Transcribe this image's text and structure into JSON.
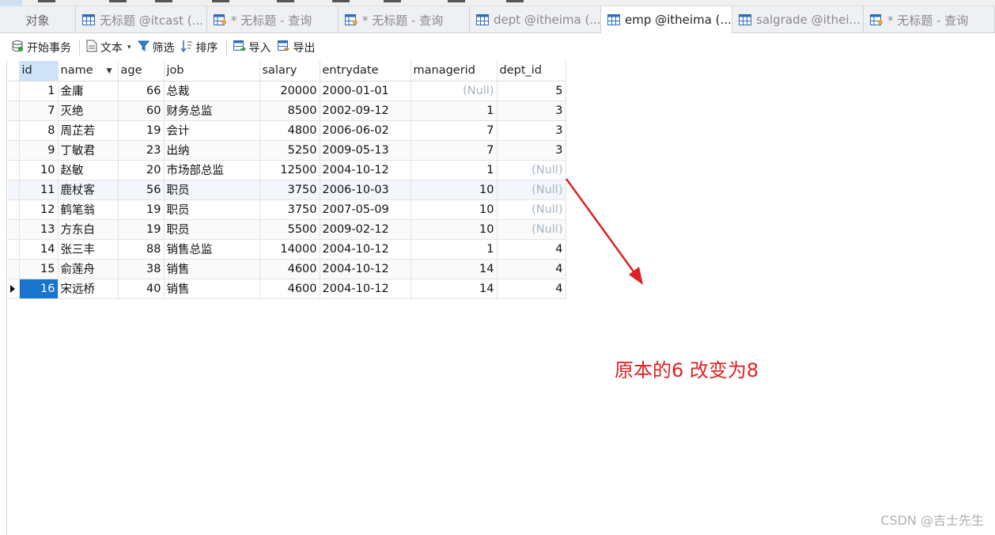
{
  "tabs": [
    {
      "label": "对象",
      "icon": "none",
      "active": false
    },
    {
      "label": "无标题 @itcast (...",
      "icon": "table-icon",
      "active": false
    },
    {
      "label": "* 无标题 - 查询",
      "icon": "query-icon",
      "active": false
    },
    {
      "label": "* 无标题 - 查询",
      "icon": "query-icon",
      "active": false
    },
    {
      "label": "dept @itheima (...",
      "icon": "table-icon",
      "active": false
    },
    {
      "label": "emp @itheima (...",
      "icon": "table-icon",
      "active": true
    },
    {
      "label": "salgrade @ithei...",
      "icon": "table-icon",
      "active": false
    },
    {
      "label": "* 无标题 - 查询",
      "icon": "query-icon",
      "active": false
    }
  ],
  "toolbar": {
    "begin_transaction": "开始事务",
    "text": "文本",
    "filter": "筛选",
    "sort": "排序",
    "import": "导入",
    "export": "导出"
  },
  "grid": {
    "columns": [
      "id",
      "name",
      "age",
      "job",
      "salary",
      "entrydate",
      "managerid",
      "dept_id"
    ],
    "null_text": "(Null)",
    "rows": [
      {
        "id": "1",
        "name": "金庸",
        "age": "66",
        "job": "总裁",
        "salary": "20000",
        "entrydate": "2000-01-01",
        "managerid": "(Null)",
        "dept_id": "5"
      },
      {
        "id": "7",
        "name": "灭绝",
        "age": "60",
        "job": "财务总监",
        "salary": "8500",
        "entrydate": "2002-09-12",
        "managerid": "1",
        "dept_id": "3"
      },
      {
        "id": "8",
        "name": "周芷若",
        "age": "19",
        "job": "会计",
        "salary": "4800",
        "entrydate": "2006-06-02",
        "managerid": "7",
        "dept_id": "3"
      },
      {
        "id": "9",
        "name": "丁敏君",
        "age": "23",
        "job": "出纳",
        "salary": "5250",
        "entrydate": "2009-05-13",
        "managerid": "7",
        "dept_id": "3"
      },
      {
        "id": "10",
        "name": "赵敏",
        "age": "20",
        "job": "市场部总监",
        "salary": "12500",
        "entrydate": "2004-10-12",
        "managerid": "1",
        "dept_id": "(Null)"
      },
      {
        "id": "11",
        "name": "鹿杖客",
        "age": "56",
        "job": "职员",
        "salary": "3750",
        "entrydate": "2006-10-03",
        "managerid": "10",
        "dept_id": "(Null)"
      },
      {
        "id": "12",
        "name": "鹤笔翁",
        "age": "19",
        "job": "职员",
        "salary": "3750",
        "entrydate": "2007-05-09",
        "managerid": "10",
        "dept_id": "(Null)"
      },
      {
        "id": "13",
        "name": "方东白",
        "age": "19",
        "job": "职员",
        "salary": "5500",
        "entrydate": "2009-02-12",
        "managerid": "10",
        "dept_id": "(Null)"
      },
      {
        "id": "14",
        "name": "张三丰",
        "age": "88",
        "job": "销售总监",
        "salary": "14000",
        "entrydate": "2004-10-12",
        "managerid": "1",
        "dept_id": "4"
      },
      {
        "id": "15",
        "name": "俞莲舟",
        "age": "38",
        "job": "销售",
        "salary": "4600",
        "entrydate": "2004-10-12",
        "managerid": "14",
        "dept_id": "4"
      },
      {
        "id": "16",
        "name": "宋远桥",
        "age": "40",
        "job": "销售",
        "salary": "4600",
        "entrydate": "2004-10-12",
        "managerid": "14",
        "dept_id": "4"
      }
    ]
  },
  "annotation": {
    "text": "原本的6 改变为8",
    "color": "#e02020"
  },
  "watermark": "CSDN @吉士先生",
  "colors": {
    "selected_cell": "#1874cd",
    "null_text": "#a8b4c4",
    "arrow": "#e02020"
  }
}
